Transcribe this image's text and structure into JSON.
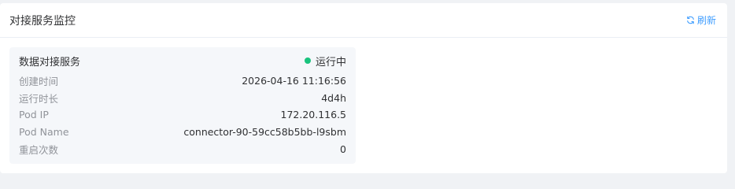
{
  "panel": {
    "title": "对接服务监控",
    "refresh_label": "刷新"
  },
  "service_card": {
    "title": "数据对接服务",
    "status_text": "运行中",
    "status_color": "#19c37d",
    "rows": [
      {
        "label": "创建时间",
        "value": "2026-04-16 11:16:56"
      },
      {
        "label": "运行时长",
        "value": "4d4h"
      },
      {
        "label": "Pod IP",
        "value": "172.20.116.5"
      },
      {
        "label": "Pod Name",
        "value": "connector-90-59cc58b5bb-l9sbm"
      },
      {
        "label": "重启次数",
        "value": "0"
      }
    ]
  },
  "colors": {
    "accent": "#409eff",
    "card_bg": "#f5f7fa"
  }
}
